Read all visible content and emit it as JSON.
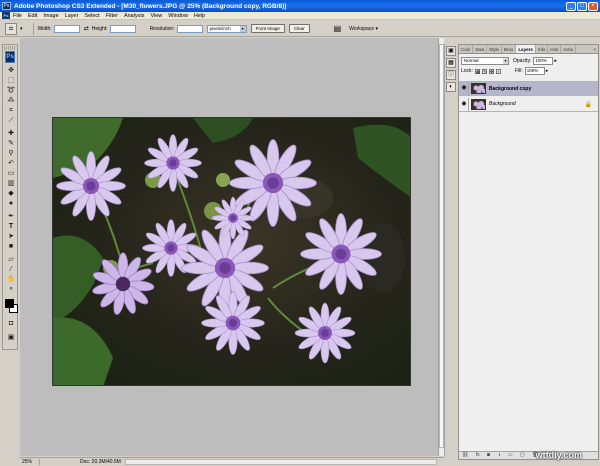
{
  "window": {
    "title": "Adobe Photoshop CS3 Extended - [M30_flowers.JPG @ 25% (Background copy, RGB/8)]",
    "app_icon": "Ps",
    "controls": [
      "_",
      "□",
      "×"
    ]
  },
  "menu": [
    "File",
    "Edit",
    "Image",
    "Layer",
    "Select",
    "Filter",
    "Analysis",
    "View",
    "Window",
    "Help"
  ],
  "options": {
    "tool_icon": "crop-icon",
    "width_label": "Width:",
    "height_label": "Height:",
    "resolution_label": "Resolution:",
    "resolution_unit": "pixels/inch",
    "front_image": "Front Image",
    "clear": "Clear",
    "workspace": "Workspace ▾"
  },
  "toolbox": {
    "logo": "Ps",
    "fg_color": "#000000",
    "bg_color": "#ffffff"
  },
  "status": {
    "zoom": "25%",
    "doc": "Doc: 20.3M/40.5M"
  },
  "layers_panel": {
    "tabs": [
      "Colo",
      "Swa",
      "Style",
      "Brus",
      "Layers",
      "Info",
      "Hist",
      "Actio"
    ],
    "active_tab": 4,
    "close": "×",
    "blend_mode": "Normal",
    "opacity_label": "Opacity:",
    "opacity": "100%",
    "lock_label": "Lock:",
    "fill_label": "Fill:",
    "fill": "100%",
    "layers": [
      {
        "name": "Background copy",
        "selected": true,
        "locked": false
      },
      {
        "name": "Background",
        "selected": false,
        "locked": true
      }
    ]
  },
  "watermark": "wtfdiy.com"
}
